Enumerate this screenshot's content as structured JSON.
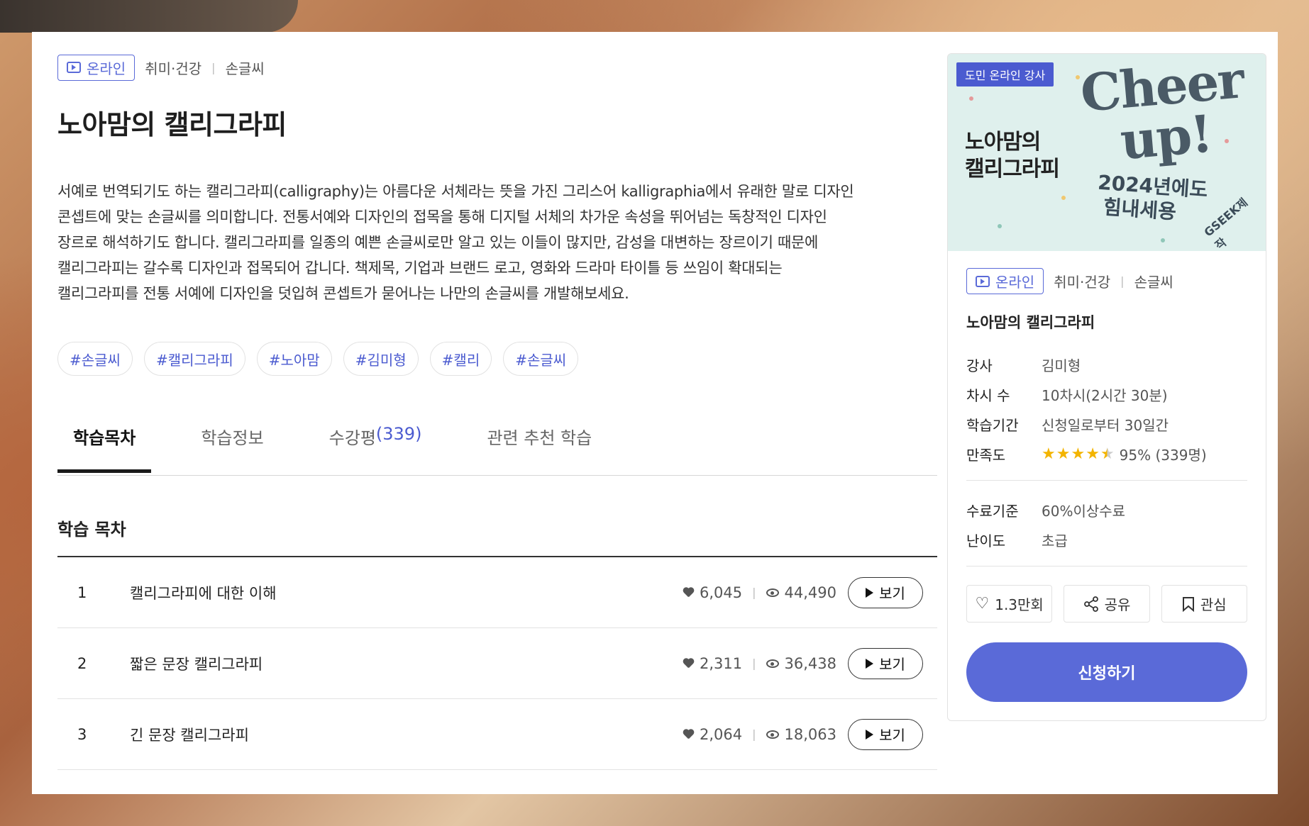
{
  "course": {
    "online_label": "온라인",
    "category": "취미·건강",
    "subcategory": "손글씨",
    "title": "노아맘의 캘리그라피",
    "description": [
      "서예로 번역되기도 하는 캘리그라피(calligraphy)는 아름다운 서체라는 뜻을 가진 그리스어 kalligraphia에서 유래한 말로 디자인",
      "콘셉트에 맞는 손글씨를 의미합니다. 전통서예와 디자인의 접목을 통해 디지털 서체의 차가운 속성을 뛰어넘는 독창적인 디자인",
      "장르로 해석하기도 합니다. 캘리그라피를 일종의 예쁜 손글씨로만 알고 있는 이들이 많지만, 감성을 대변하는 장르이기 때문에",
      "캘리그라피는 갈수록 디자인과 접목되어 갑니다. 책제목, 기업과 브랜드 로고, 영화와 드라마 타이틀 등 쓰임이 확대되는",
      "캘리그라피를 전통 서예에 디자인을 덧입혀 콘셉트가 묻어나는 나만의 손글씨를 개발해보세요."
    ],
    "tags": [
      "#손글씨",
      "#캘리그라피",
      "#노아맘",
      "#김미형",
      "#캘리",
      "#손글씨"
    ]
  },
  "tabs": {
    "toc": "학습목차",
    "info": "학습정보",
    "reviews": "수강평",
    "reviews_count": "(339)",
    "related": "관련 추천 학습"
  },
  "toc": {
    "heading": "학습 목차",
    "view_label": "보기",
    "items": [
      {
        "num": "1",
        "name": "캘리그라피에 대한 이해",
        "likes": "6,045",
        "views": "44,490"
      },
      {
        "num": "2",
        "name": "짧은 문장 캘리그라피",
        "likes": "2,311",
        "views": "36,438"
      },
      {
        "num": "3",
        "name": "긴 문장 캘리그라피",
        "likes": "2,064",
        "views": "18,063"
      }
    ]
  },
  "panel": {
    "thumb": {
      "badge": "도민 온라인 강사",
      "title_line1": "노아맘의",
      "title_line2": "캘리그라피",
      "cheer_line1": "Cheer",
      "cheer_line2": "up!",
      "sub_line1": "2024년에도",
      "sub_line2": "힘내세용",
      "mark": "GSEEK제작"
    },
    "online_label": "온라인",
    "category": "취미·건강",
    "subcategory": "손글씨",
    "title": "노아맘의 캘리그라피",
    "info": [
      {
        "k": "강사",
        "v": "김미형"
      },
      {
        "k": "차시 수",
        "v": "10차시(2시간 30분)"
      },
      {
        "k": "학습기간",
        "v": "신청일로부터 30일간"
      }
    ],
    "rating": {
      "k": "만족도",
      "v": "95% (339명)",
      "stars": 4.5
    },
    "info2": [
      {
        "k": "수료기준",
        "v": "60%이상수료"
      },
      {
        "k": "난이도",
        "v": "초급"
      }
    ],
    "like_count": "1.3만회",
    "share_label": "공유",
    "fav_label": "관심",
    "apply_label": "신청하기"
  },
  "colors": {
    "accent": "#5a6ad8",
    "star": "#f3b400"
  }
}
